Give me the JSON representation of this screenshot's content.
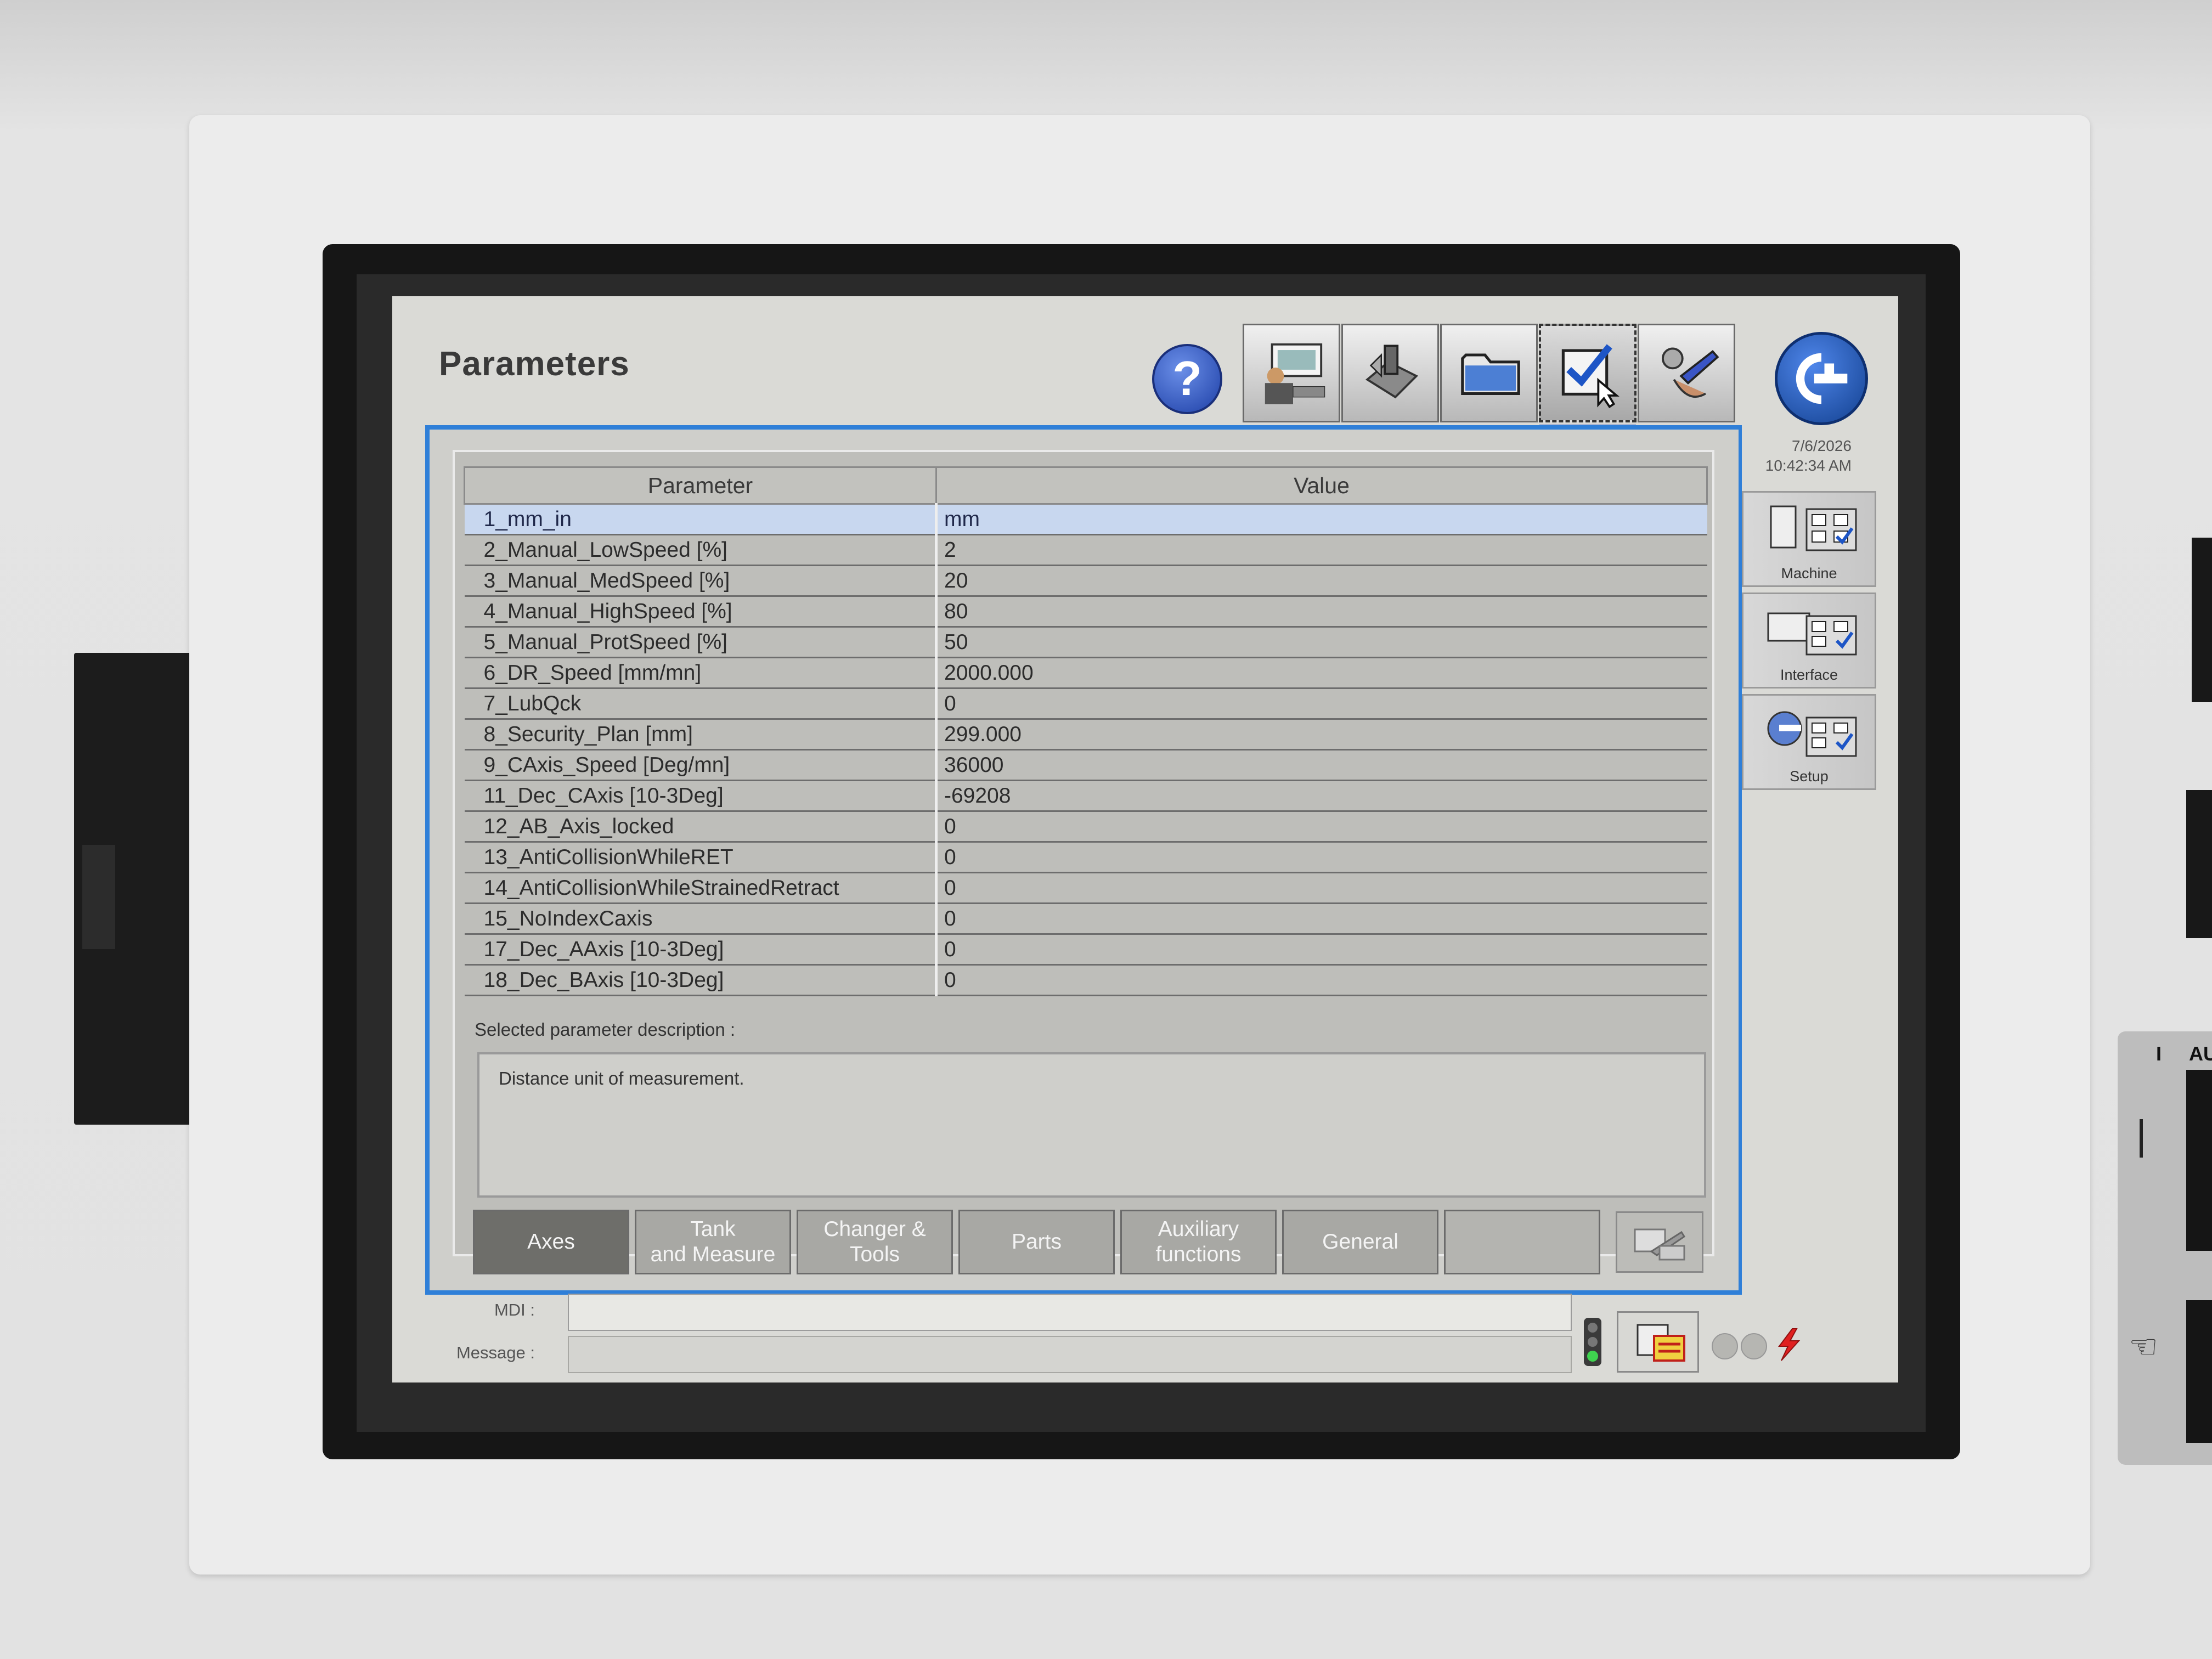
{
  "window": {
    "title": "Parameters",
    "datetime": {
      "date": "7/6/2026",
      "time": "10:42:34 AM"
    }
  },
  "toolbar": {
    "help_icon": "help-icon",
    "buttons": [
      {
        "icon": "operator-station-icon",
        "strip_color": "#3fae4f"
      },
      {
        "icon": "machine-tool-icon",
        "strip_color": "#d6262b"
      },
      {
        "icon": "folder-icon",
        "strip_color": "#2d8fd6"
      },
      {
        "icon": "checklist-cursor-icon",
        "strip_color": "#2a55c8"
      },
      {
        "icon": "maintenance-wrench-icon",
        "strip_color": "#9c6ac8"
      }
    ],
    "home_icon": "home-arrow-icon"
  },
  "side_menu": {
    "items": [
      {
        "label": "Machine",
        "icon": "machine-settings-icon"
      },
      {
        "label": "Interface",
        "icon": "interface-settings-icon"
      },
      {
        "label": "Setup",
        "icon": "setup-settings-icon"
      }
    ]
  },
  "table": {
    "headers": {
      "parameter": "Parameter",
      "value": "Value"
    },
    "rows": [
      {
        "parameter": "1_mm_in",
        "value": "mm",
        "selected": true
      },
      {
        "parameter": "2_Manual_LowSpeed [%]",
        "value": "2"
      },
      {
        "parameter": "3_Manual_MedSpeed [%]",
        "value": "20"
      },
      {
        "parameter": "4_Manual_HighSpeed [%]",
        "value": "80"
      },
      {
        "parameter": "5_Manual_ProtSpeed [%]",
        "value": "50"
      },
      {
        "parameter": "6_DR_Speed [mm/mn]",
        "value": "2000.000"
      },
      {
        "parameter": "7_LubQck",
        "value": "0"
      },
      {
        "parameter": "8_Security_Plan [mm]",
        "value": "299.000"
      },
      {
        "parameter": "9_CAxis_Speed [Deg/mn]",
        "value": "36000"
      },
      {
        "parameter": "11_Dec_CAxis [10-3Deg]",
        "value": "-69208"
      },
      {
        "parameter": "12_AB_Axis_locked",
        "value": "0"
      },
      {
        "parameter": "13_AntiCollisionWhileRET",
        "value": "0"
      },
      {
        "parameter": "14_AntiCollisionWhileStrainedRetract",
        "value": "0"
      },
      {
        "parameter": "15_NoIndexCaxis",
        "value": "0"
      },
      {
        "parameter": "17_Dec_AAxis [10-3Deg]",
        "value": "0"
      },
      {
        "parameter": "18_Dec_BAxis [10-3Deg]",
        "value": "0"
      }
    ]
  },
  "description": {
    "label": "Selected parameter description :",
    "text": "Distance unit of measurement."
  },
  "tabs": [
    {
      "label": "Axes",
      "active": true
    },
    {
      "label": "Tank\nand Measure"
    },
    {
      "label": "Changer &\nTools"
    },
    {
      "label": "Parts"
    },
    {
      "label": "Auxiliary\nfunctions"
    },
    {
      "label": "General"
    },
    {
      "label": ""
    }
  ],
  "tab_action_icon": "edit-parameters-icon",
  "status_bar": {
    "mdi_label": "MDI :",
    "mdi_value": "",
    "message_label": "Message :",
    "message_value": "",
    "icons": [
      "traffic-light-icon",
      "alarm-log-icon",
      "indicator-led-icon",
      "indicator-led-icon",
      "lightning-bolt-icon"
    ]
  },
  "colors": {
    "accent_blue": "#2f7fd8",
    "selected_row": "#c8d7ef",
    "active_tab": "#6e6e6a"
  }
}
